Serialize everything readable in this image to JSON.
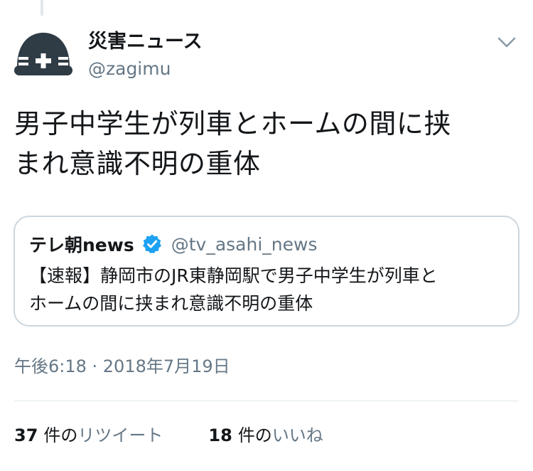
{
  "tweet": {
    "author": {
      "name": "災害ニュース",
      "handle": "@zagimu"
    },
    "text_lines": [
      "男子中学生が列車とホームの間に挟",
      "まれ意識不明の重体"
    ],
    "quoted": {
      "name": "テレ朝news",
      "handle": "@tv_asahi_news",
      "verified": true,
      "text_lines": [
        "【速報】静岡市のJR東静岡駅で男子中学生が列車と",
        "ホームの間に挟まれ意識不明の重体"
      ]
    },
    "timestamp": "午後6:18 · 2018年7月19日",
    "retweets": {
      "count": "37",
      "unit": "件の",
      "label": "リツイート"
    },
    "likes": {
      "count": "18",
      "unit": "件の",
      "label": "いいね"
    }
  },
  "icons": {
    "avatar": "helmet-avatar-icon",
    "menu": "chevron-down-icon",
    "verified": "verified-badge-icon"
  },
  "colors": {
    "verified_blue": "#1da1f2",
    "secondary_text": "#657786",
    "primary_text": "#14171a",
    "avatar_dark": "#2f3b45",
    "border": "#ccd6dd"
  }
}
